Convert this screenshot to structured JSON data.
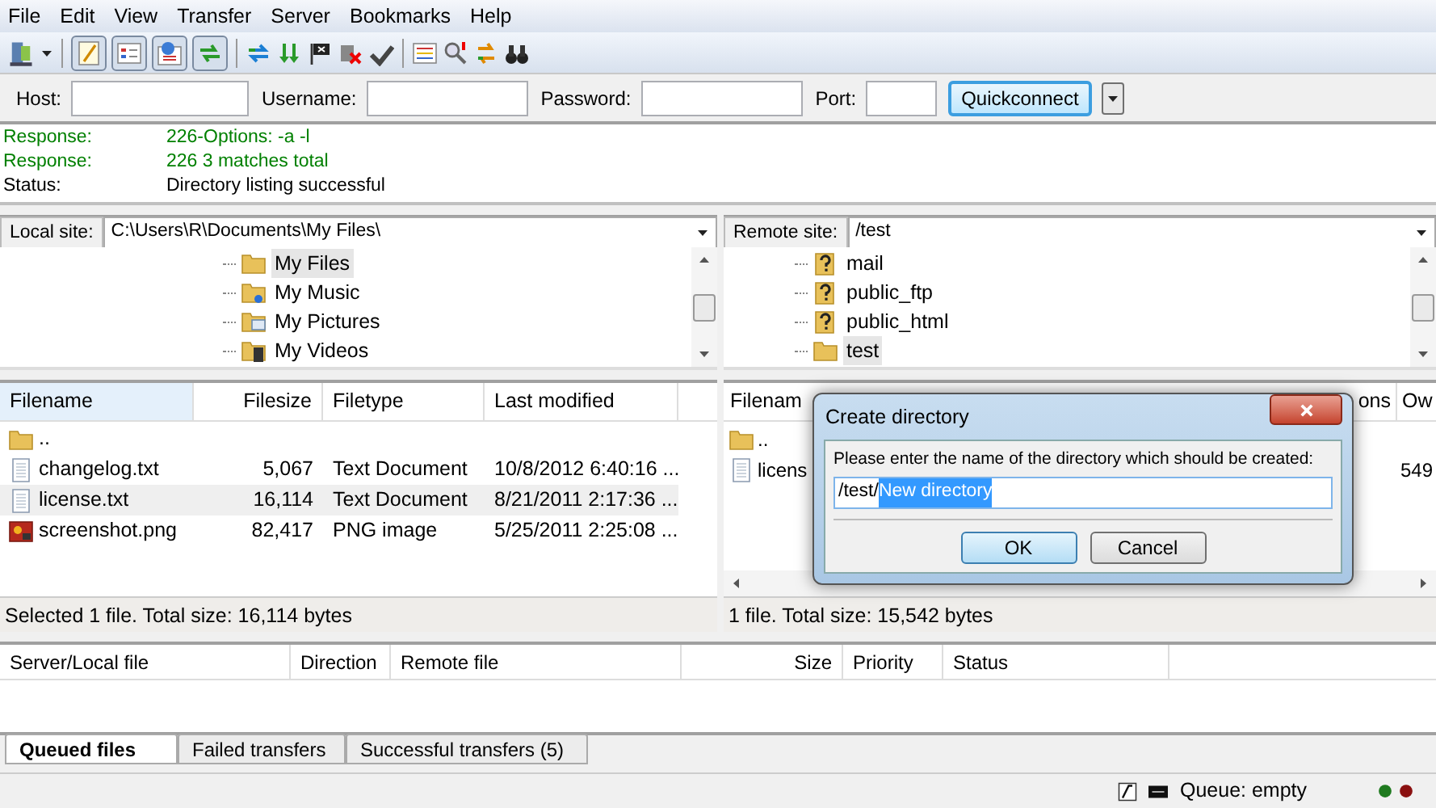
{
  "menu": [
    "File",
    "Edit",
    "View",
    "Transfer",
    "Server",
    "Bookmarks",
    "Help"
  ],
  "toolbar": {
    "toggles": [
      {
        "selected": true
      },
      {
        "selected": true
      },
      {
        "selected": true
      },
      {
        "selected": true
      }
    ]
  },
  "quickconnect": {
    "fields": [
      {
        "label": "Host:"
      },
      {
        "label": "Username:"
      },
      {
        "label": "Password:"
      },
      {
        "label": "Port:"
      }
    ],
    "button": "Quickconnect"
  },
  "log": [
    {
      "kind": "response",
      "label": "Response:",
      "text": "226-Options: -a -l"
    },
    {
      "kind": "response",
      "label": "Response:",
      "text": "226 3 matches total"
    },
    {
      "kind": "status",
      "label": "Status:",
      "text": "Directory listing successful"
    }
  ],
  "local": {
    "site_label": "Local site:",
    "path": "C:\\Users\\R\\Documents\\My Files\\",
    "tree": [
      {
        "kind": "folder",
        "name": "My Files",
        "selected": true
      },
      {
        "kind": "music",
        "name": "My Music",
        "selected": false
      },
      {
        "kind": "pictures",
        "name": "My Pictures",
        "selected": false
      },
      {
        "kind": "videos",
        "name": "My Videos",
        "selected": false
      }
    ],
    "columns": [
      "Filename",
      "Filesize",
      "Filetype",
      "Last modified"
    ],
    "rows": [
      {
        "kind": "folder",
        "name": "..",
        "selected": false
      },
      {
        "kind": "text",
        "name": "changelog.txt",
        "size": "5,067",
        "type": "Text Document",
        "modified": "10/8/2012 6:40:16 ...",
        "selected": false
      },
      {
        "kind": "text",
        "name": "license.txt",
        "size": "16,114",
        "type": "Text Document",
        "modified": "8/21/2011 2:17:36 ...",
        "selected": true
      },
      {
        "kind": "image",
        "name": "screenshot.png",
        "size": "82,417",
        "type": "PNG image",
        "modified": "5/25/2011 2:25:08 ...",
        "selected": false
      }
    ],
    "status": "Selected 1 file. Total size: 16,114 bytes"
  },
  "remote": {
    "site_label": "Remote site:",
    "path": "/test",
    "tree": [
      {
        "kind": "unknown",
        "name": "mail",
        "selected": false
      },
      {
        "kind": "unknown",
        "name": "public_ftp",
        "selected": false
      },
      {
        "kind": "unknown",
        "name": "public_html",
        "selected": false
      },
      {
        "kind": "folder",
        "name": "test",
        "selected": true
      }
    ],
    "columns": [
      "Filenam",
      "ons",
      "Ow"
    ],
    "rows": [
      {
        "kind": "folder",
        "name": ".."
      },
      {
        "kind": "text",
        "name": "licens",
        "column_3": "549"
      }
    ],
    "status": "1 file. Total size: 15,542 bytes"
  },
  "dialog": {
    "title": "Create directory",
    "prompt": "Please enter the name of the directory which should be created:",
    "value_prefix": "/test/",
    "value_selected": "New directory",
    "ok": "OK",
    "cancel": "Cancel"
  },
  "queue": {
    "columns": [
      "Server/Local file",
      "Direction",
      "Remote file",
      "Size",
      "Priority",
      "Status"
    ],
    "tabs": [
      {
        "label": "Queued files",
        "selected": true
      },
      {
        "label": "Failed transfers",
        "selected": false
      },
      {
        "label": "Successful transfers (5)",
        "selected": false
      }
    ]
  },
  "status_bar": {
    "queue": "Queue: empty"
  }
}
